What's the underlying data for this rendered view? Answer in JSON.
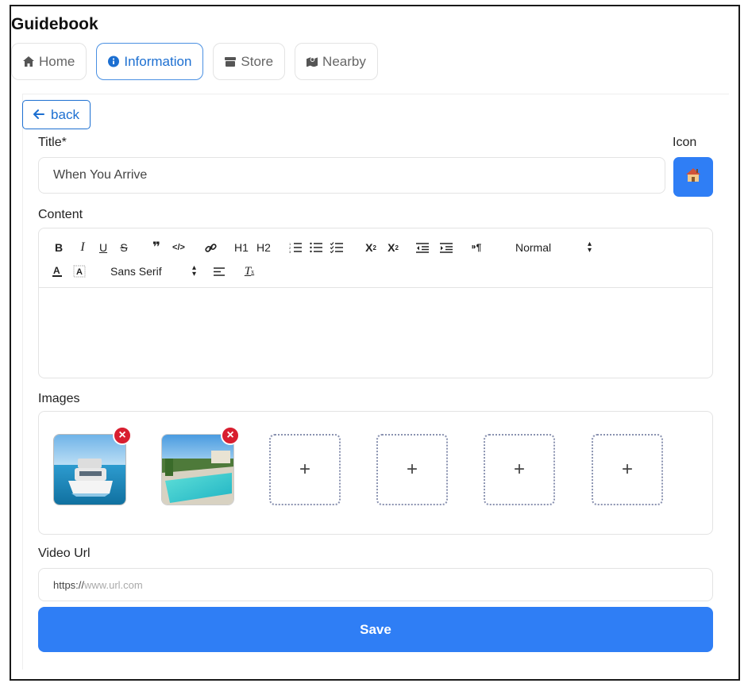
{
  "app": {
    "title": "Guidebook"
  },
  "tabs": [
    {
      "label": "Home",
      "icon": "home-icon",
      "active": false
    },
    {
      "label": "Information",
      "icon": "info-icon",
      "active": true
    },
    {
      "label": "Store",
      "icon": "store-icon",
      "active": false
    },
    {
      "label": "Nearby",
      "icon": "map-icon",
      "active": false
    }
  ],
  "back": {
    "label": "back"
  },
  "form": {
    "title_label": "Title*",
    "title_value": "When You Arrive",
    "icon_label": "Icon",
    "content_label": "Content",
    "images_label": "Images",
    "video_label": "Video Url",
    "video_prefix": "https://",
    "video_placeholder": "www.url.com",
    "save_label": "Save"
  },
  "toolbar": {
    "row1": [
      "B",
      "I",
      "U",
      "S",
      "quote-icon",
      "code-icon",
      "link-icon",
      "H1",
      "H2",
      "ordered-list-icon",
      "bullet-list-icon",
      "check-list-icon",
      "subscript-icon",
      "superscript-icon",
      "outdent-icon",
      "indent-icon",
      "text-direction-icon"
    ],
    "header_select": "Normal",
    "font_select": "Sans Serif"
  },
  "images": [
    {
      "name": "boat-image",
      "remove": "×"
    },
    {
      "name": "pool-image",
      "remove": "×"
    }
  ],
  "slots": [
    "+",
    "+",
    "+",
    "+"
  ],
  "colors": {
    "accent": "#2f7ef5",
    "remove": "#d81e2f"
  }
}
